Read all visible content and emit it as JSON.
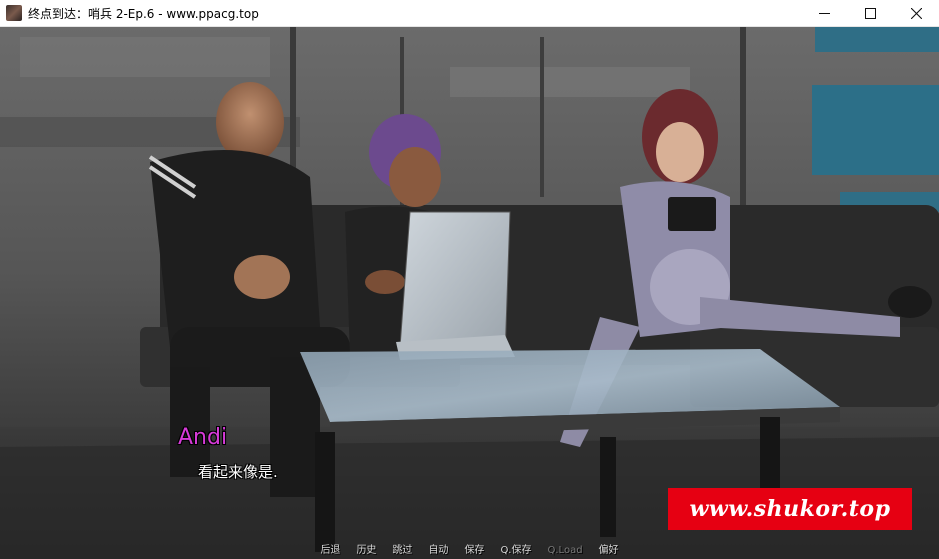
{
  "window": {
    "title": "终点到达：哨兵 2-Ep.6 - www.ppacg.top"
  },
  "dialogue": {
    "speaker": "Andi",
    "text": "看起来像是."
  },
  "watermark": {
    "text": "www.shukor.top"
  },
  "quick_menu": [
    {
      "label": "后退",
      "enabled": true
    },
    {
      "label": "历史",
      "enabled": true
    },
    {
      "label": "跳过",
      "enabled": true
    },
    {
      "label": "自动",
      "enabled": true
    },
    {
      "label": "保存",
      "enabled": true
    },
    {
      "label": "Q.保存",
      "enabled": true
    },
    {
      "label": "Q.Load",
      "enabled": false
    },
    {
      "label": "偏好",
      "enabled": true
    }
  ],
  "colors": {
    "speaker": "#d63ad8",
    "watermark_bg": "#e60012"
  }
}
